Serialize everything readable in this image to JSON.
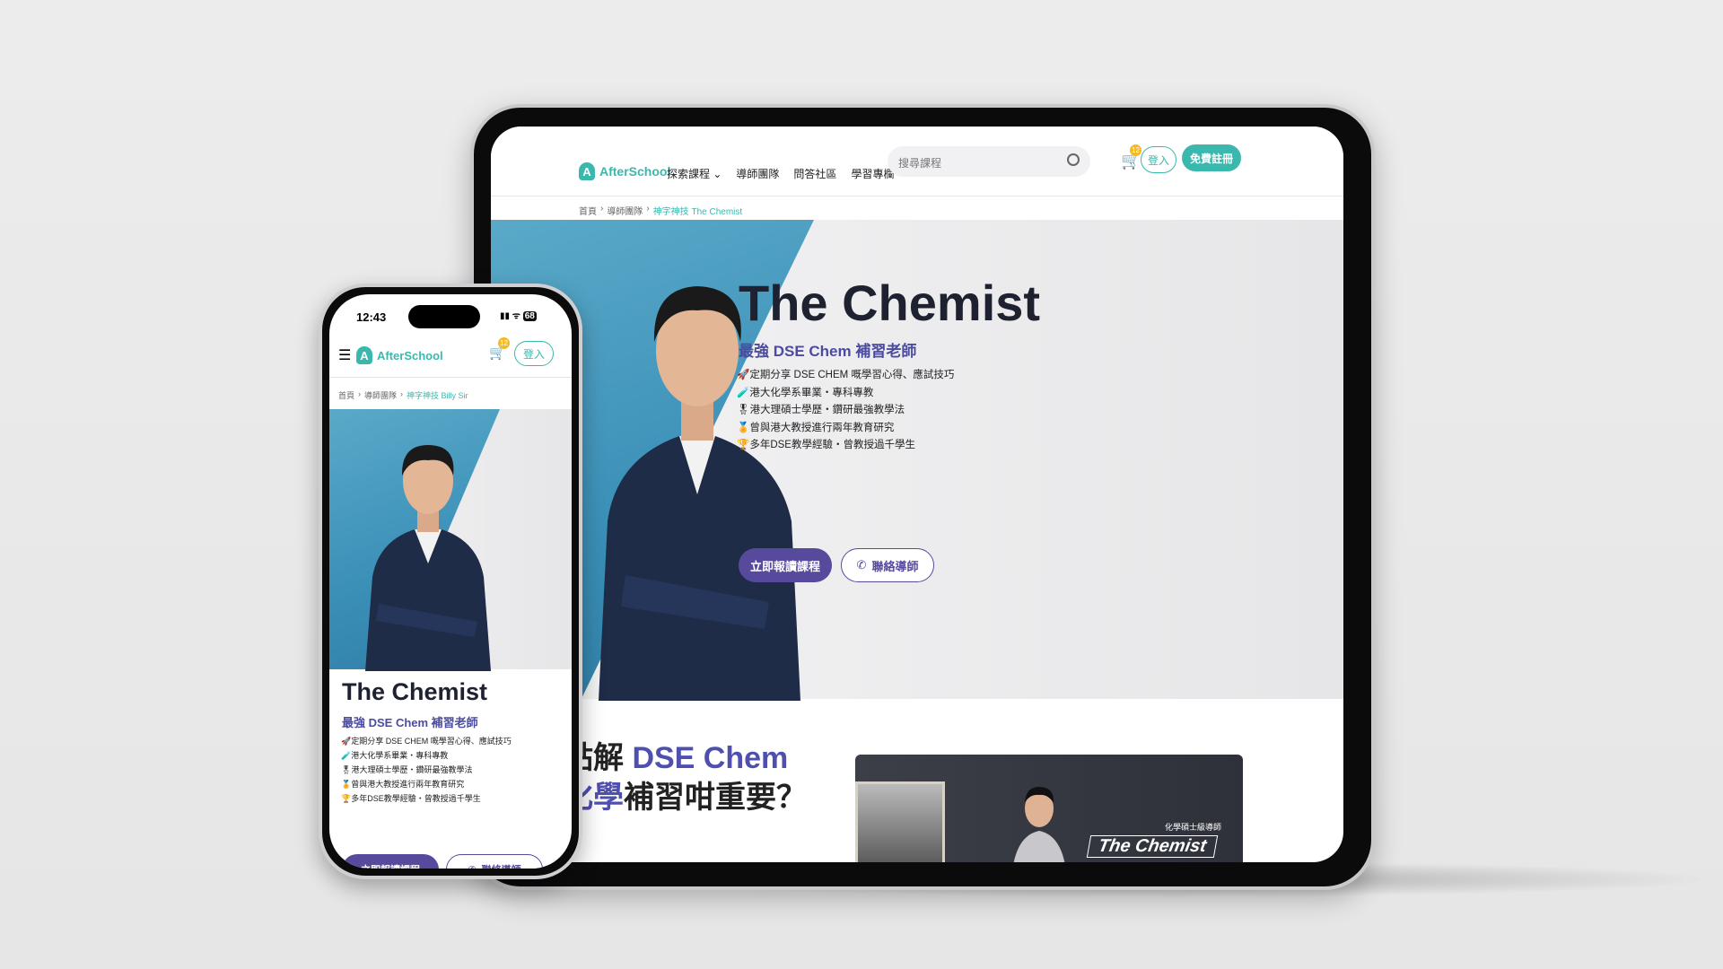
{
  "brand": "AfterSchool",
  "nav": {
    "items": [
      "探索課程",
      "導師團隊",
      "問答社區",
      "學習專欄"
    ],
    "search_placeholder": "搜尋課程",
    "cart_count": "12",
    "login": "登入",
    "register": "免費註冊"
  },
  "breadcrumb_tablet": [
    "首頁",
    "導師團隊",
    "神字神技 The Chemist"
  ],
  "breadcrumb_phone": [
    "首頁",
    "導師團隊",
    "神字神技 Billy Sir"
  ],
  "hero": {
    "title": "The Chemist",
    "subtitle": "最強 DSE Chem 補習老師",
    "points": [
      {
        "icon": "🚀",
        "text": "定期分享 DSE CHEM 嘅學習心得、應試技巧"
      },
      {
        "icon": "🧪",
        "text": "港大化學系畢業・專科專教"
      },
      {
        "icon": "🎖",
        "text": "港大理碩士學歷・鑽研最強教學法"
      },
      {
        "icon": "🏅",
        "text": "曾與港大教授進行兩年教育研究"
      },
      {
        "icon": "🏆",
        "text": "多年DSE教學經驗・曾教授過千學生"
      }
    ],
    "enroll": "立即報讀課程",
    "contact": "聯絡導師"
  },
  "section": {
    "line1_dark": "點解 ",
    "line1_accent": "DSE Chem",
    "line2_accent": "化學",
    "line2_dark": "補習咁重要？"
  },
  "video": {
    "caption_small": "化學碩士級導師",
    "caption": "The Chemist"
  },
  "phone_status": {
    "time": "12:43",
    "battery": "68"
  },
  "colors": {
    "brand": "#3bb8ad",
    "primary": "#57499b",
    "badge": "#f6b921"
  }
}
